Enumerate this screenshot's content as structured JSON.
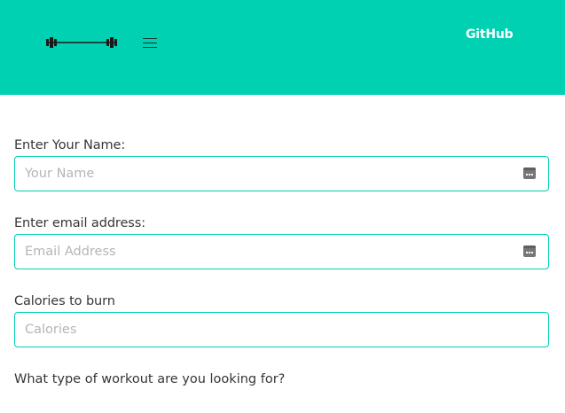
{
  "navbar": {
    "logo_icon": "barbell-icon",
    "menu_icon": "hamburger-icon",
    "github_label": "GitHub",
    "accent_color": "#00d1b2"
  },
  "form": {
    "name": {
      "label": "Enter Your Name:",
      "placeholder": "Your Name",
      "value": ""
    },
    "email": {
      "label": "Enter email address:",
      "placeholder": "Email Address",
      "value": ""
    },
    "calories": {
      "label": "Calories to burn",
      "placeholder": "Calories",
      "value": ""
    },
    "workout_question": "What type of workout are you looking for?"
  }
}
